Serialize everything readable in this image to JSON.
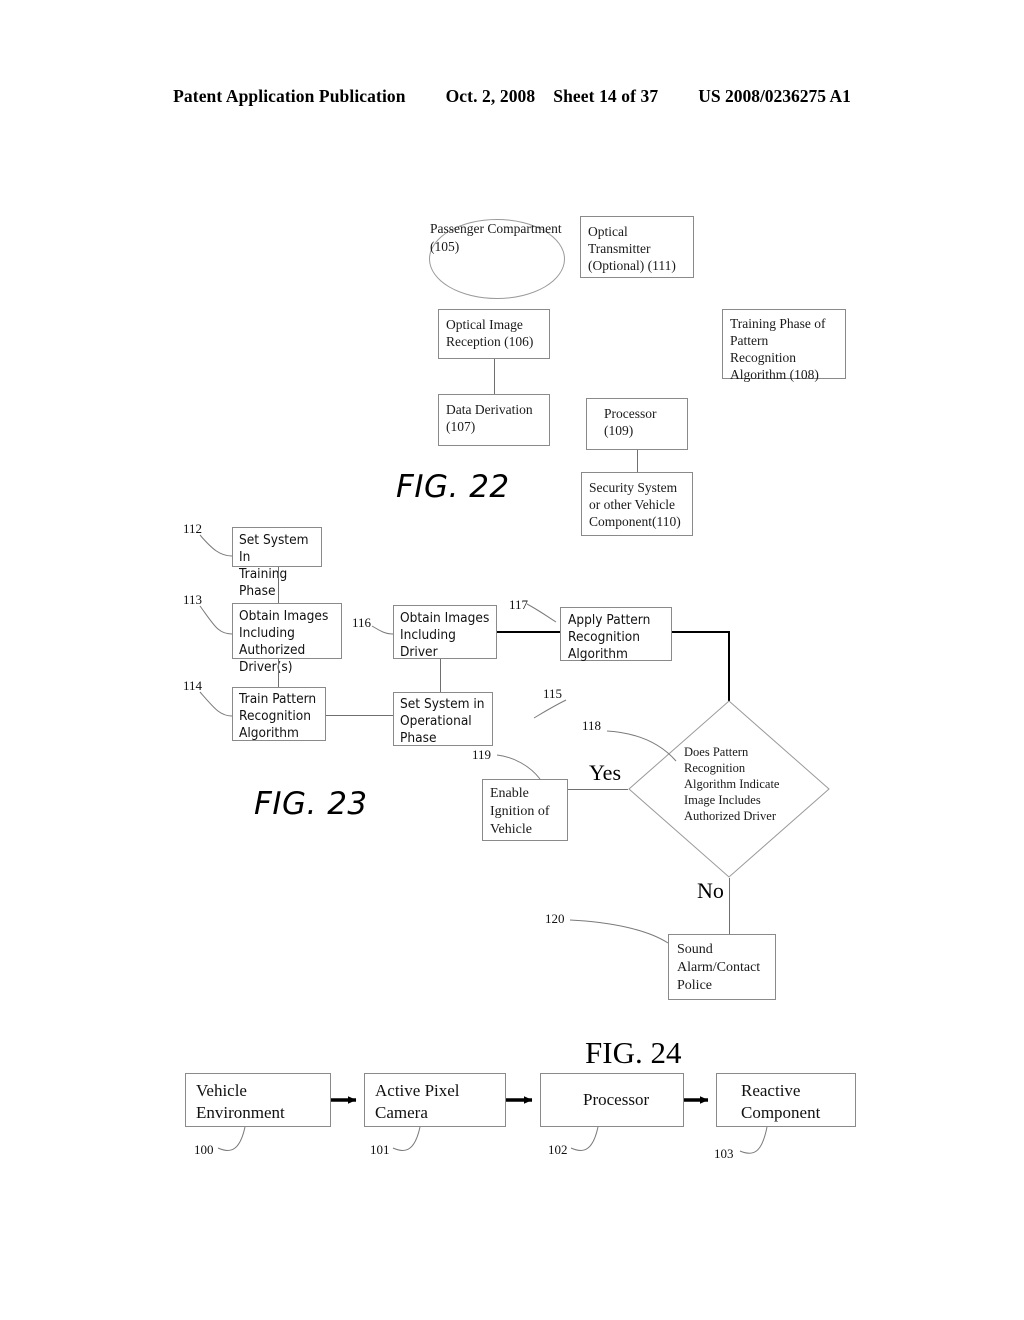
{
  "header": {
    "publication": "Patent Application Publication",
    "date": "Oct. 2, 2008",
    "sheet": "Sheet 14 of 37",
    "patent_number": "US 2008/0236275 A1"
  },
  "figures": [
    {
      "caption": "FIG. 22",
      "nodes": {
        "passenger_compartment": "Passenger\nCompartment\n(105)",
        "optical_transmitter": "Optical\nTransmitter\n(Optional) (111)",
        "optical_image_reception": "Optical Image\nReception (106)",
        "training_phase": "Training Phase of\nPattern\nRecognition\nAlgorithm (108)",
        "data_derivation": "Data Derivation\n(107)",
        "processor": "Processor\n(109)",
        "security_system": "Security System\nor other Vehicle\nComponent(110)"
      }
    },
    {
      "caption": "FIG. 23",
      "nodes": {
        "set_system_training": "Set System In\nTraining Phase",
        "obtain_images_authorized": "Obtain Images\nIncluding\nAuthorized Driver(s)",
        "train_pattern": "Train Pattern\nRecognition\nAlgorithm",
        "obtain_images_driver": "Obtain Images\nIncluding\nDriver",
        "set_system_operational": "Set System in\nOperational\nPhase",
        "apply_pattern": "Apply Pattern\nRecognition\nAlgorithm",
        "decision": "Does Pattern\nRecognition\nAlgorithm Indicate\nImage Includes\nAuthorized Driver",
        "enable_ignition": "Enable\nIgnition of\nVehicle",
        "sound_alarm": "Sound\nAlarm/Contact\nPolice"
      },
      "branches": {
        "yes": "Yes",
        "no": "No"
      },
      "reference_numerals": {
        "n112": "112",
        "n113": "113",
        "n114": "114",
        "n115": "115",
        "n116": "116",
        "n117": "117",
        "n118": "118",
        "n119": "119",
        "n120": "120"
      }
    },
    {
      "caption": "FIG. 24",
      "nodes": {
        "vehicle_environment": "Vehicle\nEnvironment",
        "active_pixel_camera": "Active Pixel\nCamera",
        "processor": "Processor",
        "reactive_component": "Reactive\nComponent"
      },
      "reference_numerals": {
        "n100": "100",
        "n101": "101",
        "n102": "102",
        "n103": "103"
      }
    }
  ],
  "colors": {
    "ink": "#000000",
    "line": "#6f6f6f",
    "box_border": "#8a8a8a",
    "paper": "#ffffff"
  }
}
